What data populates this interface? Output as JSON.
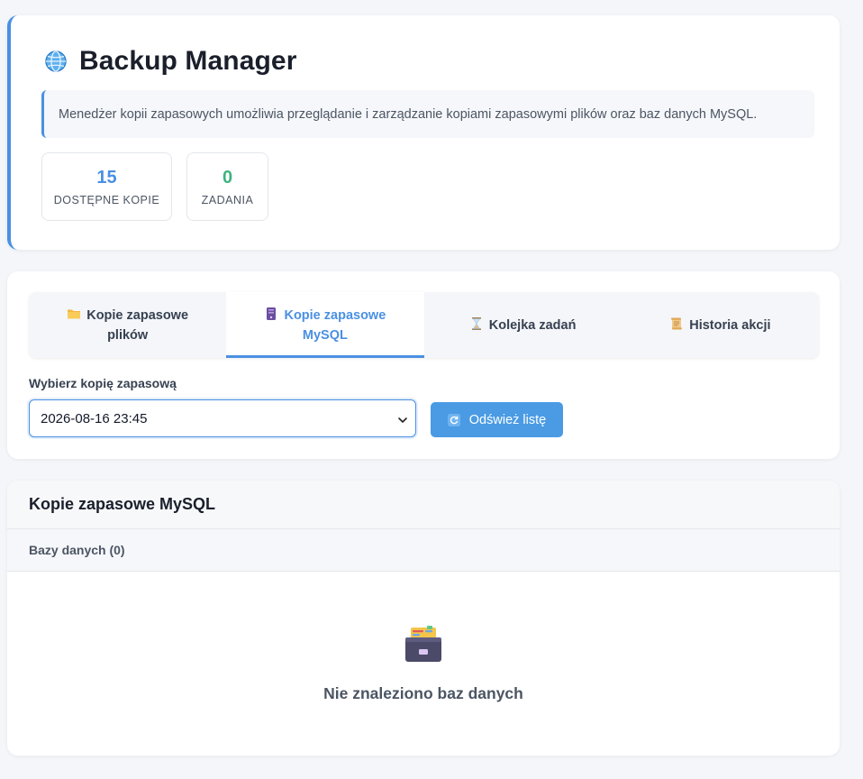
{
  "header": {
    "icon": "globe-icon",
    "title": "Backup Manager",
    "description": "Menedżer kopii zapasowych umożliwia przeglądanie i zarządzanie kopiami zapasowymi plików oraz baz danych MySQL.",
    "accent_color": "#4a90e2"
  },
  "stats": [
    {
      "value": "15",
      "label": "DOSTĘPNE KOPIE",
      "color": "#4a90e2"
    },
    {
      "value": "0",
      "label": "ZADANIA",
      "color": "#3fb27f"
    }
  ],
  "tabs": [
    {
      "icon": "folder-icon",
      "label": "Kopie zapasowe plików",
      "active": false
    },
    {
      "icon": "server-icon",
      "label": "Kopie zapasowe MySQL",
      "active": true
    },
    {
      "icon": "hourglass-icon",
      "label": "Kolejka zadań",
      "active": false
    },
    {
      "icon": "scroll-icon",
      "label": "Historia akcji",
      "active": false
    }
  ],
  "backup_select": {
    "label": "Wybierz kopię zapasową",
    "selected": "2026-08-16 23:45"
  },
  "refresh": {
    "icon": "refresh-icon",
    "label": "Odśwież listę"
  },
  "results": {
    "title": "Kopie zapasowe MySQL",
    "subtitle": "Bazy danych (0)",
    "empty_icon": "file-cabinet-icon",
    "empty_text": "Nie znaleziono baz danych"
  }
}
